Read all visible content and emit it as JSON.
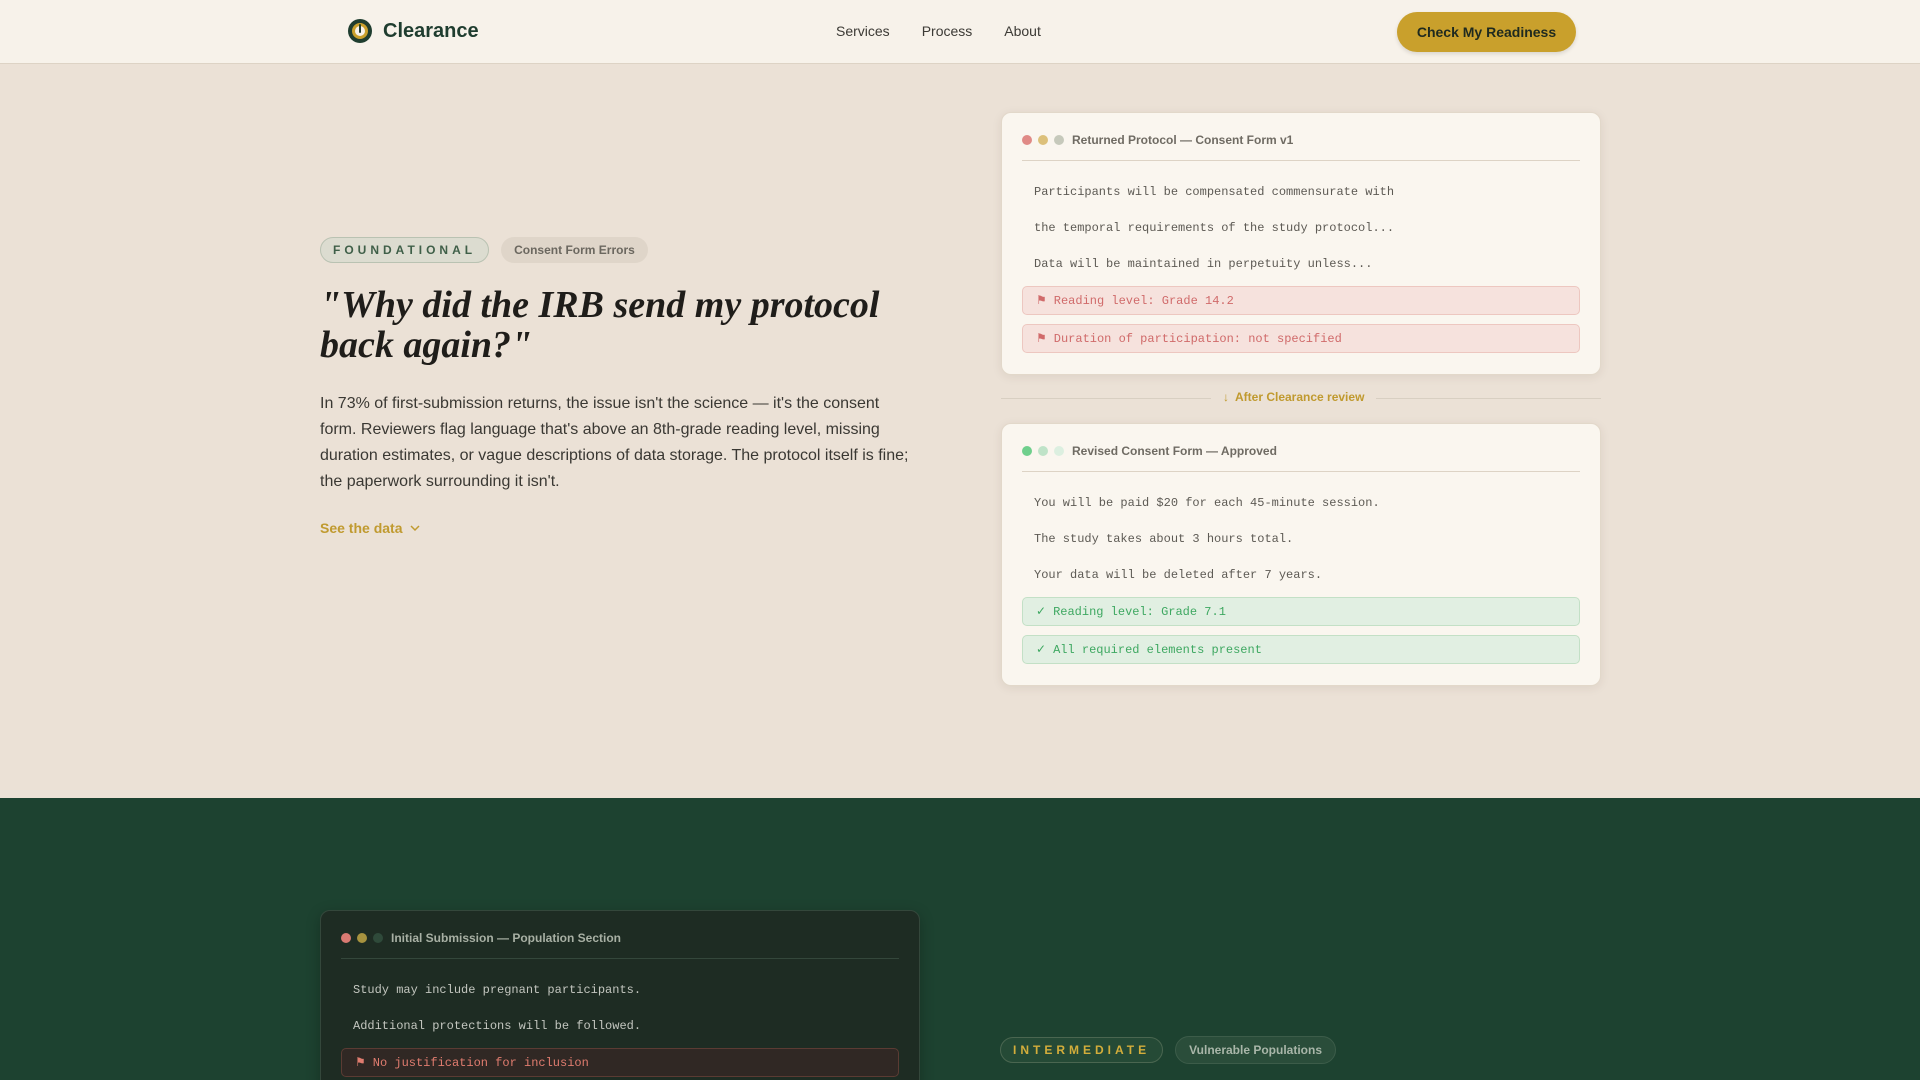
{
  "header": {
    "brand": "Clearance",
    "nav": [
      "Services",
      "Process",
      "About"
    ],
    "cta": "Check My Readiness"
  },
  "hero": {
    "level_tag": "FOUNDATIONAL",
    "topic_tag": "Consent Form Errors",
    "title": "\"Why did the IRB send my protocol back again?\"",
    "body": "In 73% of first-submission returns, the issue isn't the science — it's the consent form. Reviewers flag language that's above an 8th-grade reading level, missing duration estimates, or vague descriptions of data storage. The protocol itself is fine; the paperwork surrounding it isn't.",
    "link": "See the data"
  },
  "returned_card": {
    "title": "Returned Protocol — Consent Form v1",
    "lines": [
      "Participants will be compensated commensurate with",
      "the temporal requirements of the study protocol...",
      "Data will be maintained in perpetuity unless..."
    ],
    "flags": [
      "Reading level: Grade 14.2",
      "Duration of participation: not specified"
    ]
  },
  "divider": {
    "label": "After Clearance review"
  },
  "revised_card": {
    "title": "Revised Consent Form — Approved",
    "lines": [
      "You will be paid $20 for each 45-minute session.",
      "The study takes about 3 hours total.",
      "Your data will be deleted after 7 years."
    ],
    "checks": [
      "Reading level: Grade 7.1",
      "All required elements present"
    ]
  },
  "second": {
    "card_title": "Initial Submission — Population Section",
    "lines": [
      "Study may include pregnant participants.",
      "Additional protections will be followed."
    ],
    "flag": "No justification for inclusion",
    "level_tag": "INTERMEDIATE",
    "topic_tag": "Vulnerable Populations"
  },
  "icons": {
    "flag": "flag-icon",
    "check": "check-icon",
    "arrow_down": "arrow-down-icon",
    "chevron": "chevron-down-icon"
  },
  "colors": {
    "accent": "#c9a02c",
    "brand_green": "#1f3d2f",
    "dark_section": "#1d4230",
    "error": "#d06a6a",
    "success": "#3ea861"
  }
}
